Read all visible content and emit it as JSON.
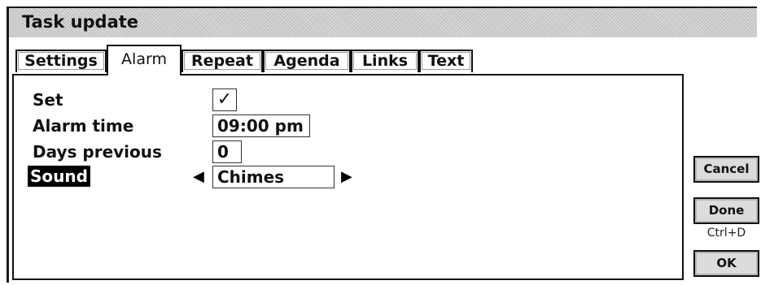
{
  "window": {
    "title": "Task update"
  },
  "tabs": [
    {
      "label": "Settings"
    },
    {
      "label": "Alarm"
    },
    {
      "label": "Repeat"
    },
    {
      "label": "Agenda"
    },
    {
      "label": "Links"
    },
    {
      "label": "Text"
    }
  ],
  "active_tab": "Alarm",
  "form": {
    "set": {
      "label": "Set",
      "checked": true,
      "check_glyph": "✓"
    },
    "alarm_time": {
      "label": "Alarm time",
      "value": "09:00 pm"
    },
    "days_previous": {
      "label": "Days previous",
      "value": "0"
    },
    "sound": {
      "label": "Sound",
      "value": "Chimes",
      "left_glyph": "◀",
      "right_glyph": "▶"
    }
  },
  "buttons": {
    "cancel": "Cancel",
    "done": "Done",
    "done_shortcut": "Ctrl+D",
    "ok": "OK"
  }
}
